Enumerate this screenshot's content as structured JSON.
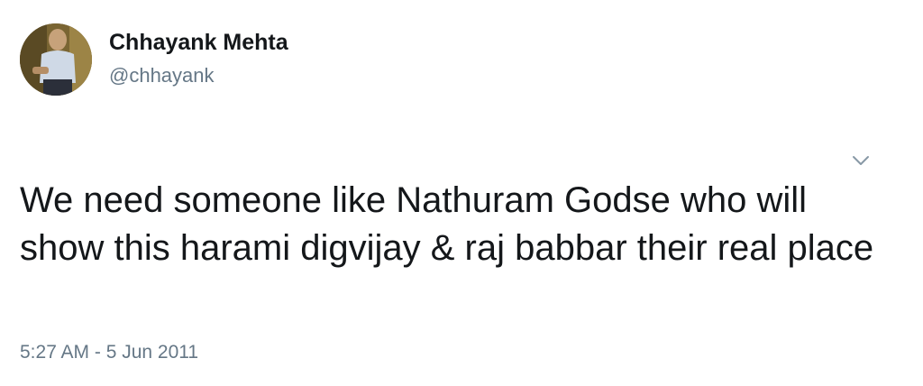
{
  "author": {
    "display_name": "Chhayank Mehta",
    "handle": "@chhayank"
  },
  "tweet": {
    "text": "We need someone like Nathuram Godse who will show this harami digvijay & raj babbar their real place",
    "timestamp": "5:27 AM - 5 Jun 2011"
  },
  "icons": {
    "menu": "chevron-down-icon"
  },
  "colors": {
    "text": "#14171a",
    "secondary": "#657786"
  }
}
